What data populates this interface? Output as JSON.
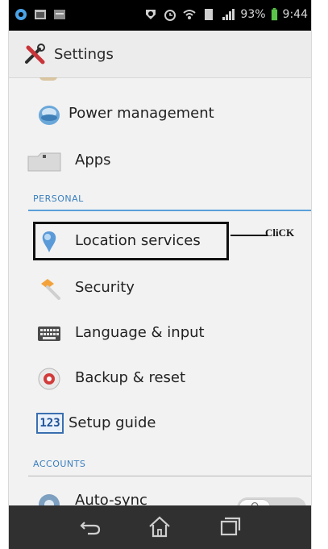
{
  "status_bar": {
    "battery_percent": "93%",
    "time": "9:44"
  },
  "action_bar": {
    "title": "Settings",
    "icon": "settings-tools-icon"
  },
  "list": {
    "power_management": "Power management",
    "apps": "Apps",
    "section_personal": "PERSONAL",
    "location_services": "Location services",
    "security": "Security",
    "language_input": "Language & input",
    "backup_reset": "Backup & reset",
    "setup_guide": "Setup guide",
    "setup_guide_icon_text": "123",
    "section_accounts": "ACCOUNTS",
    "auto_sync": "Auto-sync",
    "auto_sync_state": "O"
  },
  "annotation": {
    "click_label": "CliCK"
  },
  "colors": {
    "accent": "#3a7fbf",
    "divider": "#5aa0d8",
    "navbar": "#303030",
    "statusbar": "#000000"
  },
  "icons": {
    "nav_back": "back-icon",
    "nav_home": "home-icon",
    "nav_recents": "recents-icon"
  }
}
